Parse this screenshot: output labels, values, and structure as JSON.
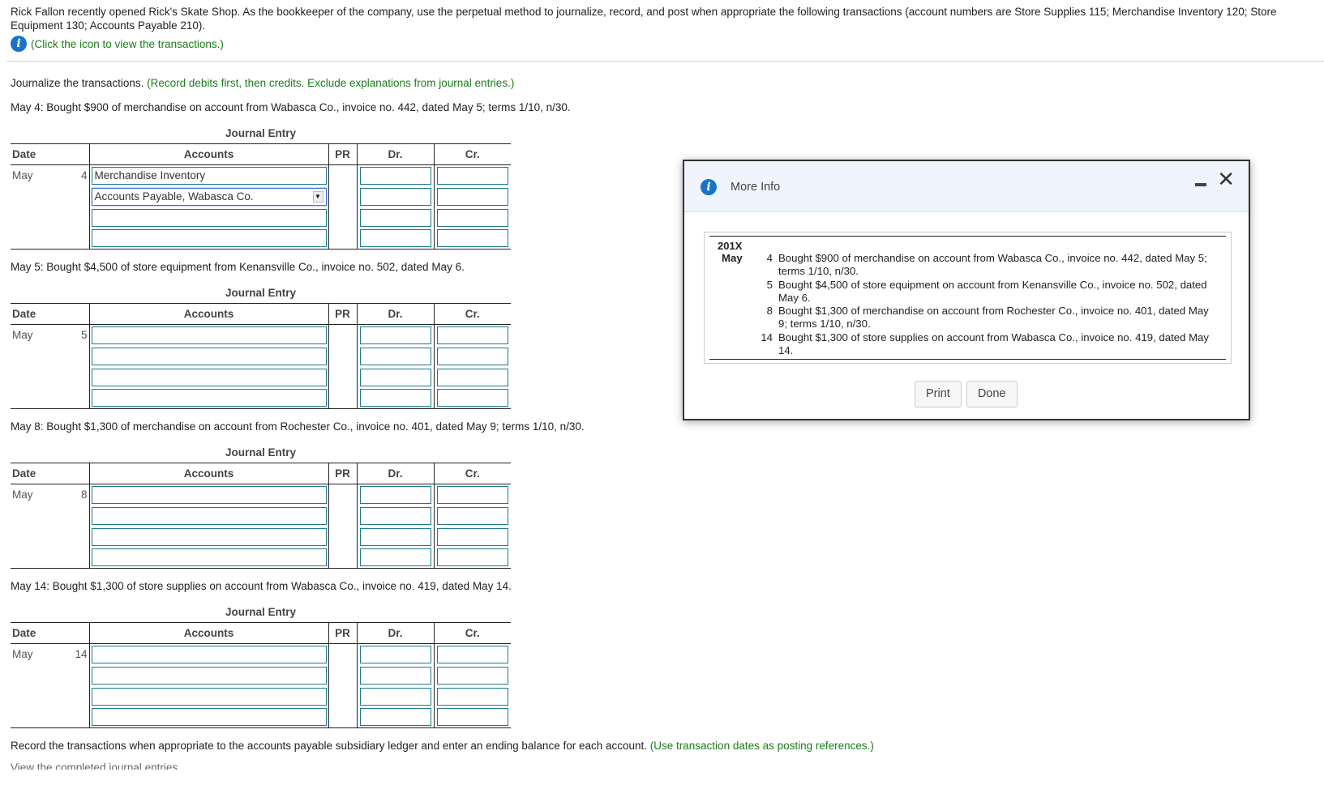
{
  "intro": {
    "text": "Rick Fallon recently opened Rick's Skate Shop. As the bookkeeper of the company, use the perpetual method to journalize, record, and post when appropriate the following transactions (account numbers are Store Supplies 115; Merchandise Inventory 120; Store Equipment 130; Accounts Payable 210).",
    "info_link": "(Click the icon to view the transactions.)"
  },
  "instructions": {
    "main": "Journalize the transactions.",
    "hint": "(Record debits first, then credits. Exclude explanations from journal entries.)"
  },
  "journal_title": "Journal Entry",
  "columns": {
    "date": "Date",
    "accounts": "Accounts",
    "pr": "PR",
    "dr": "Dr.",
    "cr": "Cr."
  },
  "entries": [
    {
      "prompt": "May 4: Bought $900 of merchandise on account from Wabasca Co., invoice no. 442, dated May 5; terms 1/10, n/30.",
      "month": "May",
      "day": "4",
      "rows": [
        {
          "account": "Merchandise Inventory",
          "dr": "",
          "cr": ""
        },
        {
          "account": "Accounts Payable, Wabasca Co.",
          "dr": "",
          "cr": "",
          "dropdown": true
        },
        {
          "account": "",
          "dr": "",
          "cr": ""
        },
        {
          "account": "",
          "dr": "",
          "cr": ""
        }
      ]
    },
    {
      "prompt": "May 5: Bought $4,500 of store equipment from Kenansville Co., invoice no. 502, dated May 6.",
      "month": "May",
      "day": "5",
      "rows": [
        {
          "account": "",
          "dr": "",
          "cr": ""
        },
        {
          "account": "",
          "dr": "",
          "cr": ""
        },
        {
          "account": "",
          "dr": "",
          "cr": ""
        },
        {
          "account": "",
          "dr": "",
          "cr": ""
        }
      ]
    },
    {
      "prompt": "May 8: Bought $1,300 of merchandise on account from Rochester Co., invoice no. 401, dated May 9; terms 1/10, n/30.",
      "month": "May",
      "day": "8",
      "rows": [
        {
          "account": "",
          "dr": "",
          "cr": ""
        },
        {
          "account": "",
          "dr": "",
          "cr": ""
        },
        {
          "account": "",
          "dr": "",
          "cr": ""
        },
        {
          "account": "",
          "dr": "",
          "cr": ""
        }
      ]
    },
    {
      "prompt": "May 14: Bought $1,300 of store supplies on account from Wabasca Co., invoice no. 419, dated May 14.",
      "month": "May",
      "day": "14",
      "rows": [
        {
          "account": "",
          "dr": "",
          "cr": ""
        },
        {
          "account": "",
          "dr": "",
          "cr": ""
        },
        {
          "account": "",
          "dr": "",
          "cr": ""
        },
        {
          "account": "",
          "dr": "",
          "cr": ""
        }
      ]
    }
  ],
  "footer": {
    "main": "Record the transactions when appropriate to the accounts payable subsidiary ledger and enter an ending balance for each account.",
    "hint": "(Use transaction dates as posting references.)",
    "cutoff": "View the completed journal entries."
  },
  "modal": {
    "title": "More Info",
    "year": "201X",
    "month": "May",
    "transactions": [
      {
        "day": "4",
        "text": "Bought $900 of merchandise on account from Wabasca Co., invoice no. 442, dated May 5; terms 1/10, n/30."
      },
      {
        "day": "5",
        "text": "Bought $4,500 of store equipment on account from Kenansville Co., invoice no. 502, dated May 6."
      },
      {
        "day": "8",
        "text": "Bought $1,300 of merchandise on account from Rochester Co., invoice no. 401, dated May 9; terms 1/10, n/30."
      },
      {
        "day": "14",
        "text": "Bought $1,300 of store supplies on account from Wabasca Co., invoice no. 419, dated May 14."
      }
    ],
    "print_label": "Print",
    "done_label": "Done",
    "minimize_icon": "minimize-icon",
    "close_icon": "close-icon"
  },
  "colors": {
    "accent_green": "#1a7d1a",
    "info_blue": "#1b73c9",
    "field_border": "#1c7a8c"
  }
}
